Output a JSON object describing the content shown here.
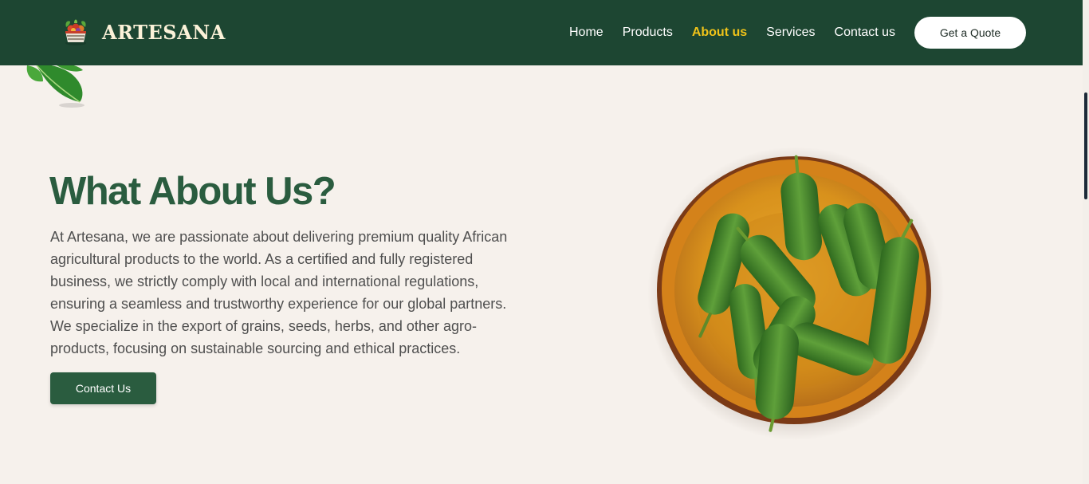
{
  "brand": {
    "name": "ARTESANA",
    "logo_icon": "basket-logo-icon"
  },
  "nav": {
    "links": [
      {
        "label": "Home",
        "active": false
      },
      {
        "label": "Products",
        "active": false
      },
      {
        "label": "About us",
        "active": true
      },
      {
        "label": "Services",
        "active": false
      },
      {
        "label": "Contact us",
        "active": false
      }
    ],
    "quote_button": "Get a Quote"
  },
  "hero": {
    "title": "What About Us?",
    "description": "At Artesana, we are passionate about delivering premium quality African agricultural products to the world. As a certified and fully registered business, we strictly comply with local and international regulations, ensuring a seamless and trustworthy experience for our global partners. We specialize in the export of grains, seeds, herbs, and other agro-products, focusing on sustainable sourcing and ethical practices.",
    "contact_button": "Contact Us",
    "image": "bowl-of-cucumbers"
  },
  "colors": {
    "nav_bg": "#1d4632",
    "accent": "#f0c319",
    "heading": "#2a5c3f",
    "page_bg": "#f6f1ec",
    "button_bg": "#2a5c3f"
  }
}
